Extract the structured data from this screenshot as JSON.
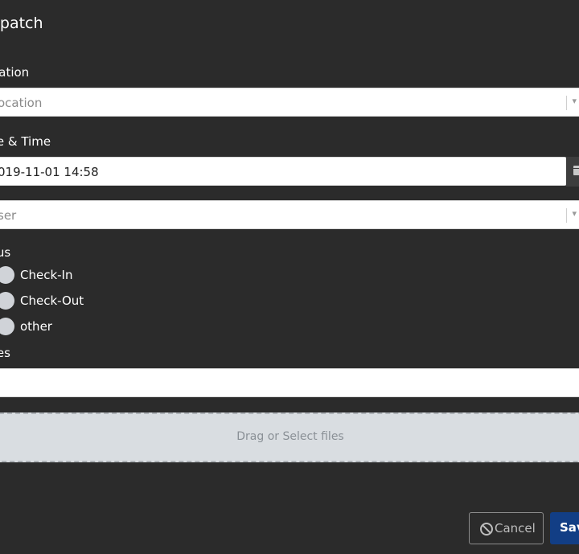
{
  "dialog": {
    "title": "spatch"
  },
  "location": {
    "label": "cation",
    "placeholder": "ocation"
  },
  "datetime": {
    "label": "te & Time",
    "value": "019-11-01 14:58"
  },
  "user": {
    "placeholder": "ser"
  },
  "status": {
    "label": "tus",
    "options": [
      "Check-In",
      "Check-Out",
      "other"
    ]
  },
  "notes": {
    "label": "tes"
  },
  "upload": {
    "text": "Drag or Select files"
  },
  "buttons": {
    "cancel": "Cancel",
    "save": "Sav"
  },
  "colors": {
    "background": "#2b2b2b",
    "primary": "#123e85",
    "dropzone": "#d9dde1"
  }
}
